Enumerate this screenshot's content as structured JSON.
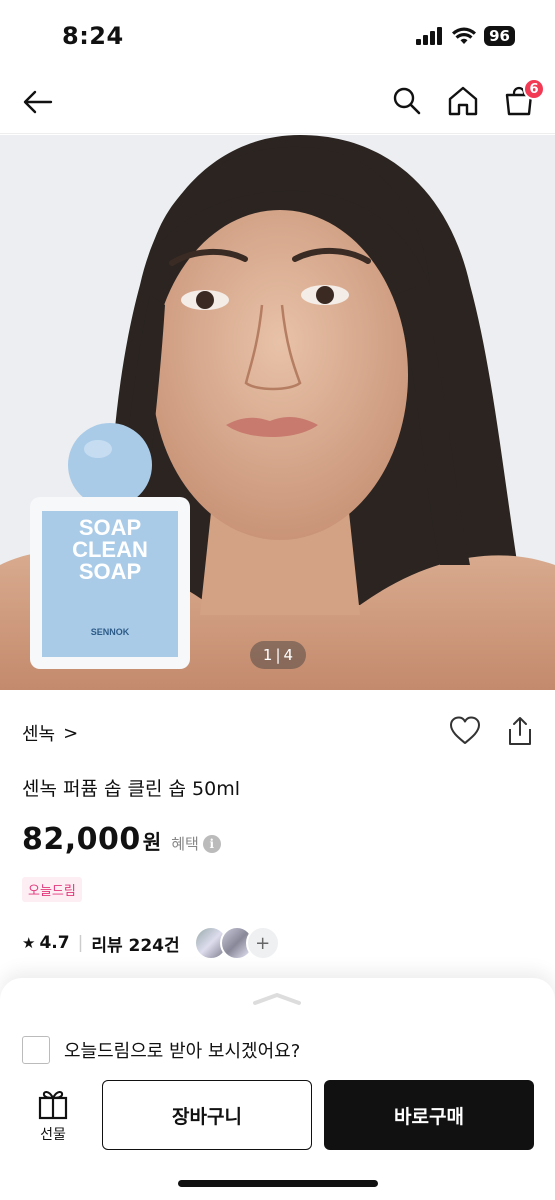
{
  "status": {
    "time": "8:24",
    "battery": "96"
  },
  "nav": {
    "cart_count": "6"
  },
  "hero": {
    "page_current": "1",
    "page_separator": "|",
    "page_total": "4",
    "product_label_line1": "SOAP",
    "product_label_line2": "CLEAN",
    "product_label_line3": "SOAP",
    "product_brand_on_bottle": "SENNOK"
  },
  "product": {
    "brand": "센녹",
    "brand_chevron": ">",
    "title": "센녹 퍼퓸 솝 클린 솝 50ml",
    "price": "82,000",
    "price_unit": "원",
    "benefit_label": "혜택",
    "benefit_info": "i",
    "tag": "오늘드림",
    "rating_star": "★",
    "rating": "4.7",
    "review_separator": "|",
    "review_label": "리뷰 224건",
    "avatar_more": "+"
  },
  "sheet": {
    "checkbox_label": "오늘드림으로 받아 보시겠어요?",
    "gift_label": "선물",
    "cart_button": "장바구니",
    "buy_button": "바로구매"
  },
  "colors": {
    "badge": "#f33a55",
    "tag_text": "#e2387b",
    "tag_bg": "#fdeef4",
    "primary": "#111111"
  }
}
